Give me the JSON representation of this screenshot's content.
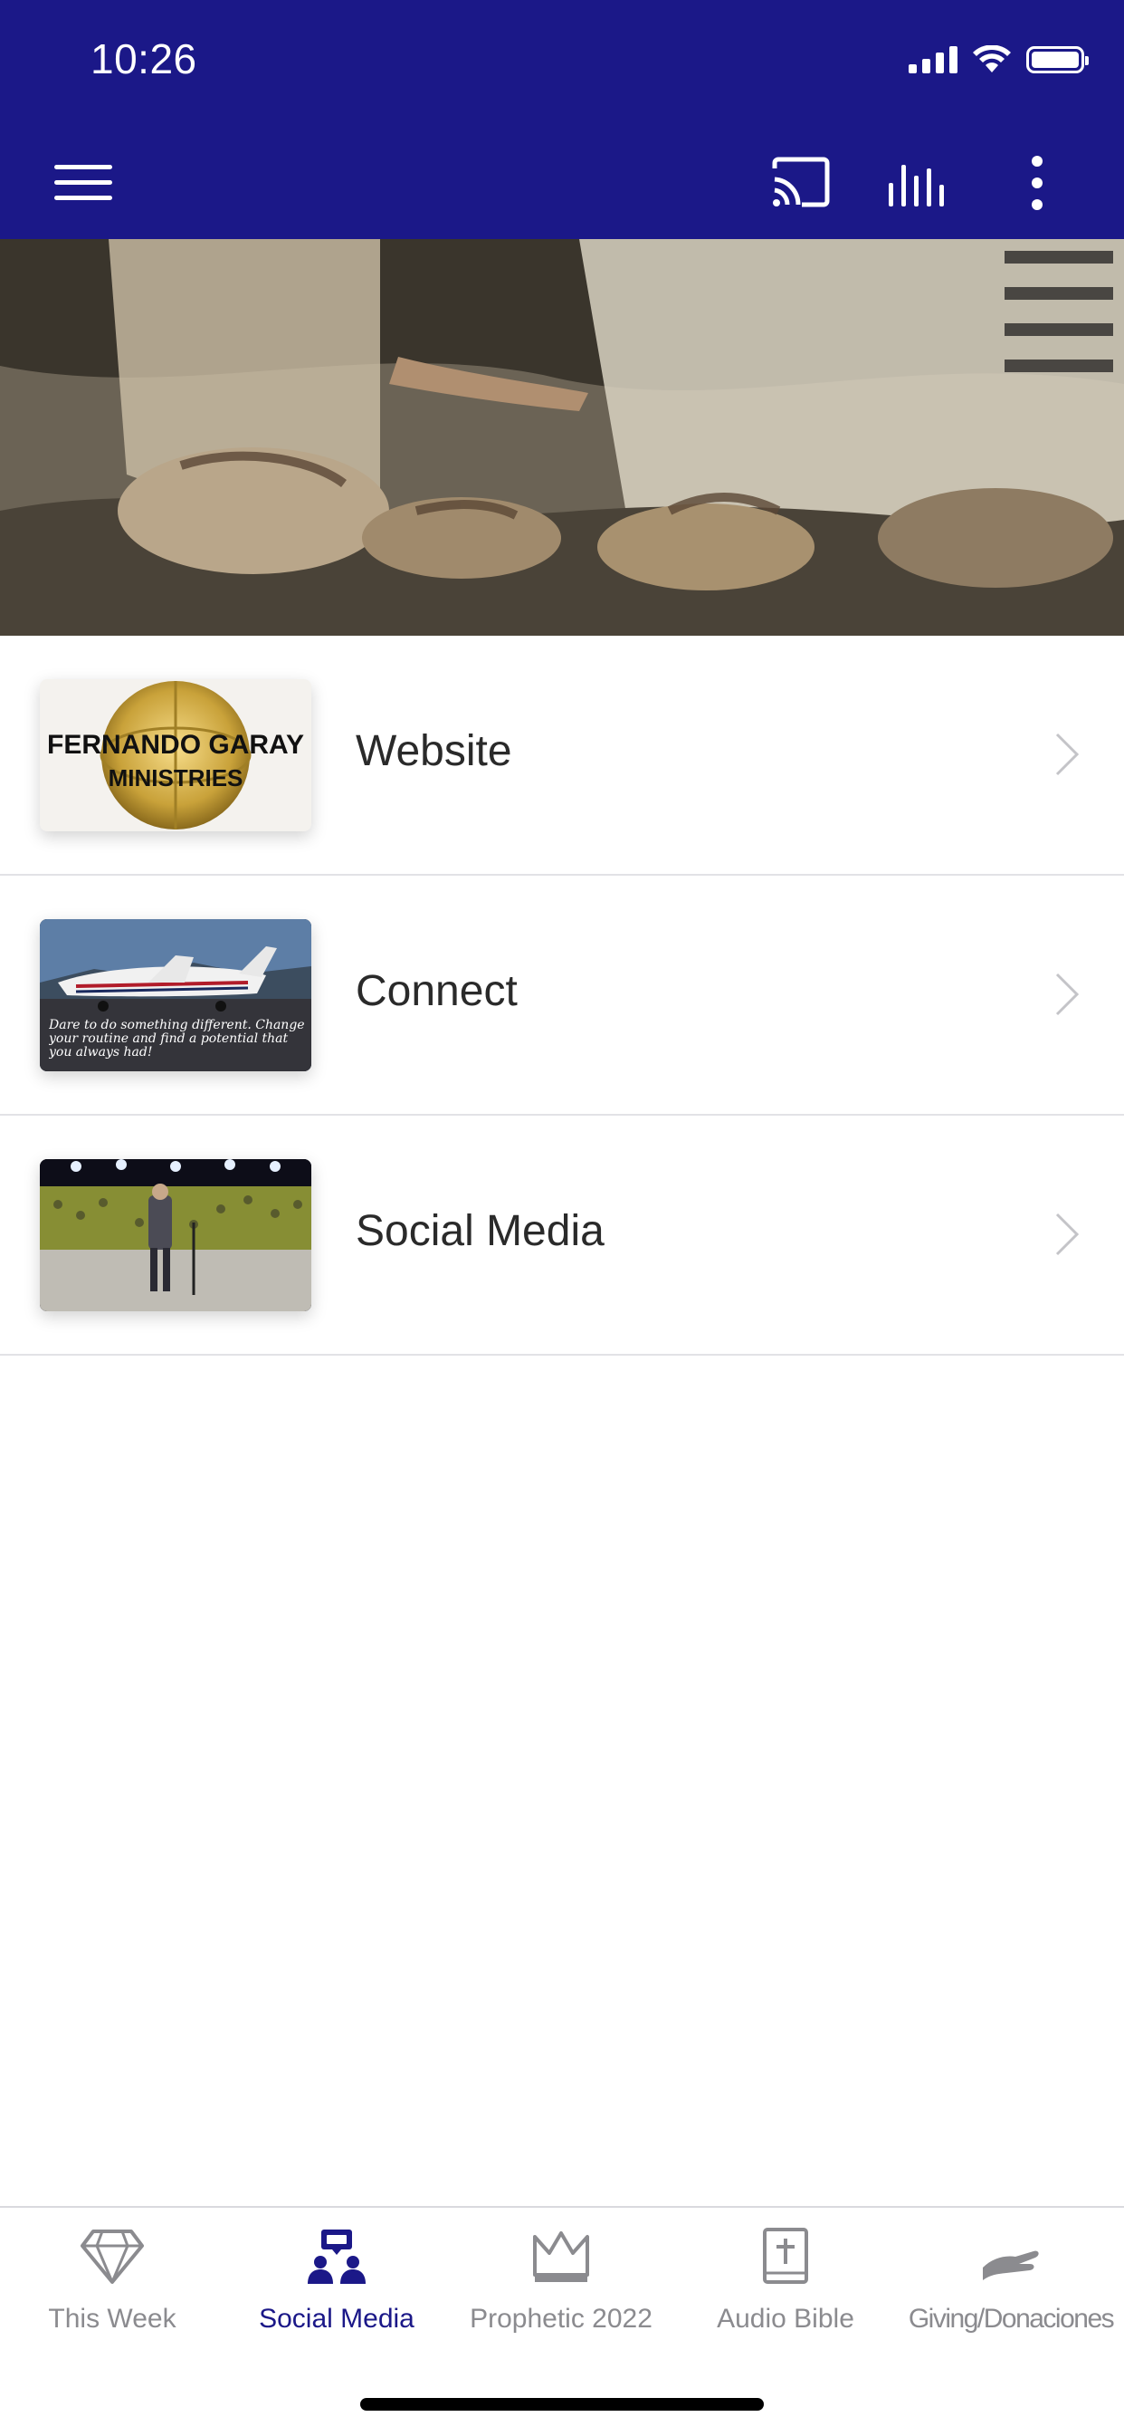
{
  "status_bar": {
    "time": "10:26"
  },
  "app_bar": {
    "menu_icon": "hamburger-menu-icon",
    "actions": [
      "cast-icon",
      "audio-bars-icon",
      "more-vertical-icon"
    ]
  },
  "items": [
    {
      "label": "Website",
      "thumb_text_line1": "FERNANDO GARAY",
      "thumb_text_line2": "MINISTRIES"
    },
    {
      "label": "Connect",
      "thumb_caption": "Dare to do something different. Change your routine and find a potential that you always had!"
    },
    {
      "label": "Social Media"
    }
  ],
  "tabs": [
    {
      "label": "This Week",
      "icon": "diamond-icon",
      "active": false
    },
    {
      "label": "Social Media",
      "icon": "people-chat-icon",
      "active": true
    },
    {
      "label": "Prophetic 2022",
      "icon": "crown-icon",
      "active": false
    },
    {
      "label": "Audio Bible",
      "icon": "bible-icon",
      "active": false
    },
    {
      "label": "Giving/Donaciones",
      "icon": "giving-hand-icon",
      "active": false
    }
  ],
  "colors": {
    "primary": "#1b1888",
    "inactive": "#8b8b8f",
    "divider": "#e2e2e6"
  }
}
